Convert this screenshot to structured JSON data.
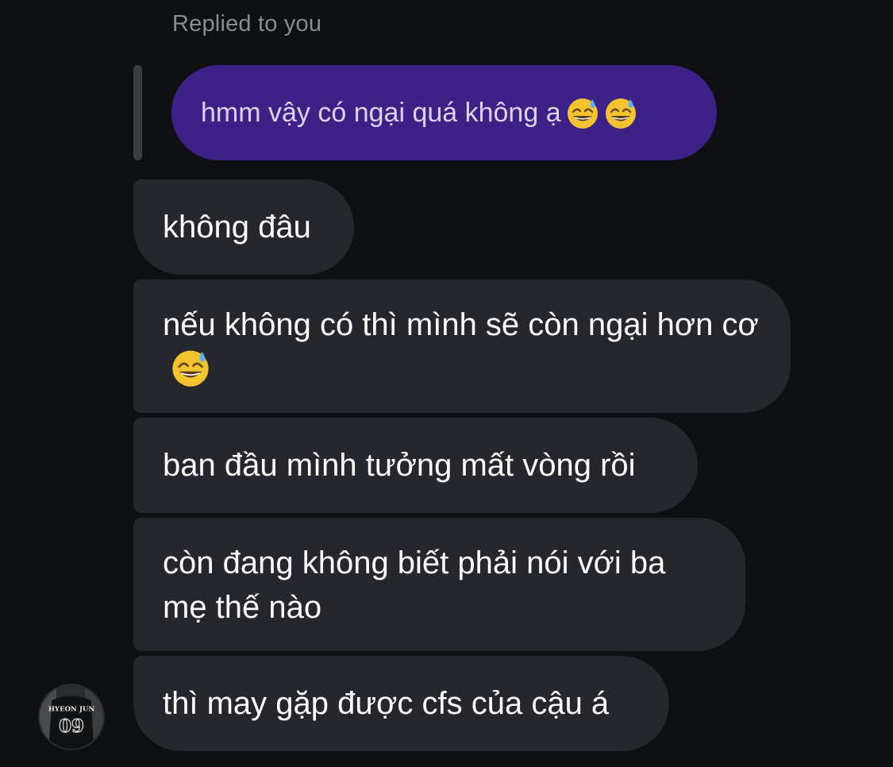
{
  "reply_context": {
    "label": "Replied to you"
  },
  "quoted_message": {
    "text": "hmm vậy có ngại quá không ạ",
    "emojis": [
      "grinning-face-with-sweat-icon",
      "grinning-face-with-sweat-icon"
    ],
    "bubble_color": "#3e2186"
  },
  "messages": [
    {
      "text": "không đâu"
    },
    {
      "text": "nếu không có thì mình sẽ còn ngại hơn cơ",
      "emoji": "grinning-face-with-sweat-icon"
    },
    {
      "text": "ban đầu mình tưởng mất vòng rồi"
    },
    {
      "text": "còn đang không biết phải nói với ba mẹ thế nào"
    },
    {
      "text": "thì may gặp được cfs của cậu á"
    }
  ],
  "avatar": {
    "jersey_name": "HYEON JUN",
    "jersey_number": "09"
  },
  "colors": {
    "background": "#0e1014",
    "incoming_bubble": "#25272c",
    "reply_bar": "#3a3c41",
    "muted_text": "#8b8d92"
  }
}
